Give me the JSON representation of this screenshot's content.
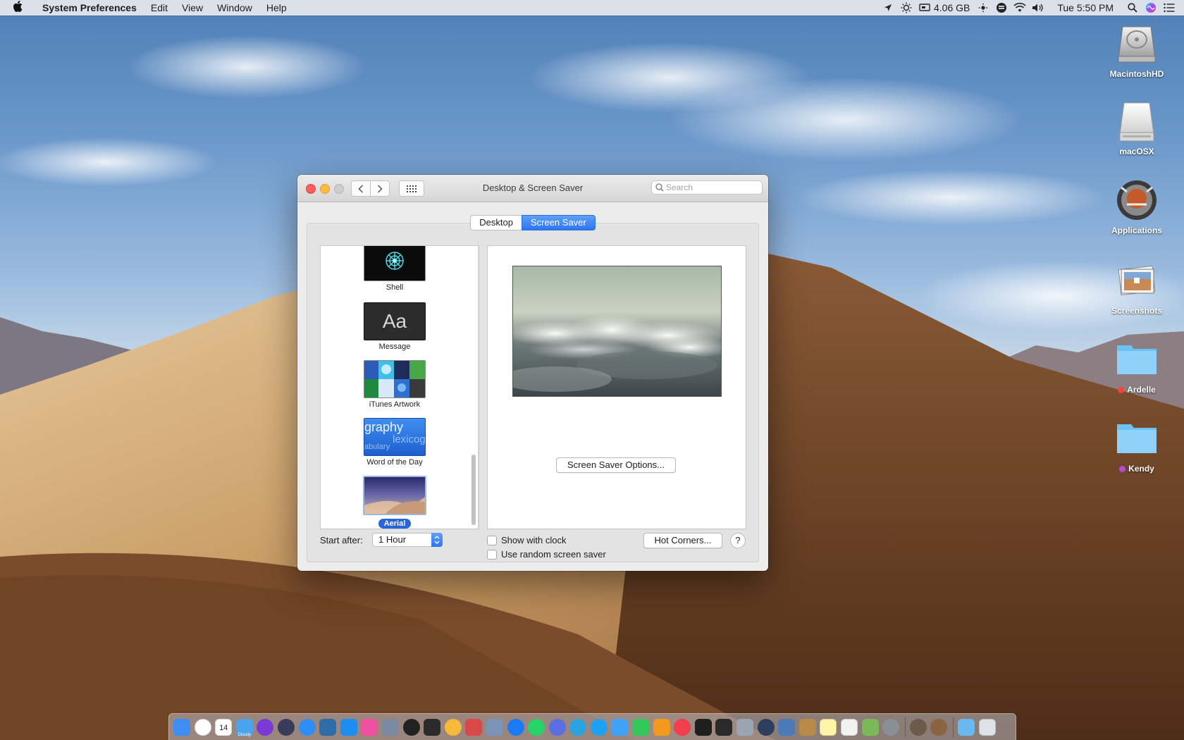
{
  "menubar": {
    "app_name": "System Preferences",
    "menus": [
      "Edit",
      "View",
      "Window",
      "Help"
    ],
    "memory": "4.06 GB",
    "clock": "Tue 5:50 PM"
  },
  "desktop_icons": [
    {
      "label": "MacintoshHD",
      "icon": "hard-drive-icon"
    },
    {
      "label": "macOSX",
      "icon": "external-drive-icon"
    },
    {
      "label": "Applications",
      "icon": "applications-icon"
    },
    {
      "label": "Screenshots",
      "icon": "screenshots-icon"
    },
    {
      "label": "Ardelle",
      "icon": "folder-icon",
      "tag_color": "#f2453d"
    },
    {
      "label": "Kendy",
      "icon": "folder-icon",
      "tag_color": "#b34bd8"
    }
  ],
  "window": {
    "title": "Desktop & Screen Saver",
    "search_placeholder": "Search",
    "tabs": [
      {
        "label": "Desktop",
        "active": false
      },
      {
        "label": "Screen Saver",
        "active": true
      }
    ],
    "savers": [
      {
        "name": "Shell"
      },
      {
        "name": "Message",
        "thumb_text": "Aa"
      },
      {
        "name": "iTunes Artwork"
      },
      {
        "name": "Word of the Day",
        "thumb_text": "graphy",
        "thumb_sub": "lexicog",
        "thumb_sub2": "abulary"
      },
      {
        "name": "Aerial",
        "selected": true
      }
    ],
    "options_button": "Screen Saver Options...",
    "start_after_label": "Start after:",
    "start_after_value": "1 Hour",
    "show_clock_label": "Show with clock",
    "random_label": "Use random screen saver",
    "hot_corners_button": "Hot Corners...",
    "help_button": "?"
  },
  "dock": {
    "weather_label": "Cloudy",
    "calendar_day": "14",
    "apps": [
      {
        "icon": "finder-icon",
        "color": "#3d8ef0"
      },
      {
        "icon": "clock-icon",
        "color": "#ffffff"
      },
      {
        "icon": "calendar-icon",
        "color": "#ffffff"
      },
      {
        "icon": "weather-icon",
        "color": "#4aa3ef"
      },
      {
        "icon": "siri-icon",
        "color": "#7a3ad6"
      },
      {
        "icon": "launchpad-icon",
        "color": "#3a3a5a"
      },
      {
        "icon": "safari-icon",
        "color": "#2f8ef5"
      },
      {
        "icon": "dev-tools-icon",
        "color": "#2e6ca8"
      },
      {
        "icon": "app-store-icon",
        "color": "#1f8cf2"
      },
      {
        "icon": "itunes-icon",
        "color": "#f050a0"
      },
      {
        "icon": "rocket-icon",
        "color": "#7b8aa0"
      },
      {
        "icon": "activity-icon",
        "color": "#222222"
      },
      {
        "icon": "photo-booth-icon",
        "color": "#2b2b2b"
      },
      {
        "icon": "photos-icon",
        "color": "#f6b93b"
      },
      {
        "icon": "mail-stamp-icon",
        "color": "#d84a4a"
      },
      {
        "icon": "preview-icon",
        "color": "#7a93b6"
      },
      {
        "icon": "messenger-icon",
        "color": "#1b7af5"
      },
      {
        "icon": "whatsapp-icon",
        "color": "#25d366"
      },
      {
        "icon": "discord-icon",
        "color": "#5b6ee1"
      },
      {
        "icon": "telegram-icon",
        "color": "#2aa3de"
      },
      {
        "icon": "twitter-icon",
        "color": "#1da1f2"
      },
      {
        "icon": "messages-icon",
        "color": "#3fa2f7"
      },
      {
        "icon": "facetime-icon",
        "color": "#34c759"
      },
      {
        "icon": "home-icon",
        "color": "#f39a1e"
      },
      {
        "icon": "news-icon",
        "color": "#f23d4c"
      },
      {
        "icon": "stocks-icon",
        "color": "#1f1f1f"
      },
      {
        "icon": "voice-memos-icon",
        "color": "#2a2a2a"
      },
      {
        "icon": "disk-utility-icon",
        "color": "#9aa5b1"
      },
      {
        "icon": "quicktime-icon",
        "color": "#2d3d5c"
      },
      {
        "icon": "image-capture-icon",
        "color": "#4a7ab8"
      },
      {
        "icon": "notefile-icon",
        "color": "#b88a4a"
      },
      {
        "icon": "notes-icon",
        "color": "#fff5a8"
      },
      {
        "icon": "textedit-icon",
        "color": "#f2f2f2"
      },
      {
        "icon": "maps-icon",
        "color": "#7ab85a"
      },
      {
        "icon": "system-preferences-icon",
        "color": "#8a8f96"
      }
    ],
    "recents": [
      {
        "icon": "mojave-icon",
        "color": "#6d5a48"
      },
      {
        "icon": "mojave-installer-icon",
        "color": "#8a6440"
      }
    ],
    "stacks": [
      {
        "icon": "folder-stack-icon",
        "color": "#69b8f0"
      },
      {
        "icon": "trash-icon",
        "color": "#dfe3e8"
      }
    ]
  }
}
